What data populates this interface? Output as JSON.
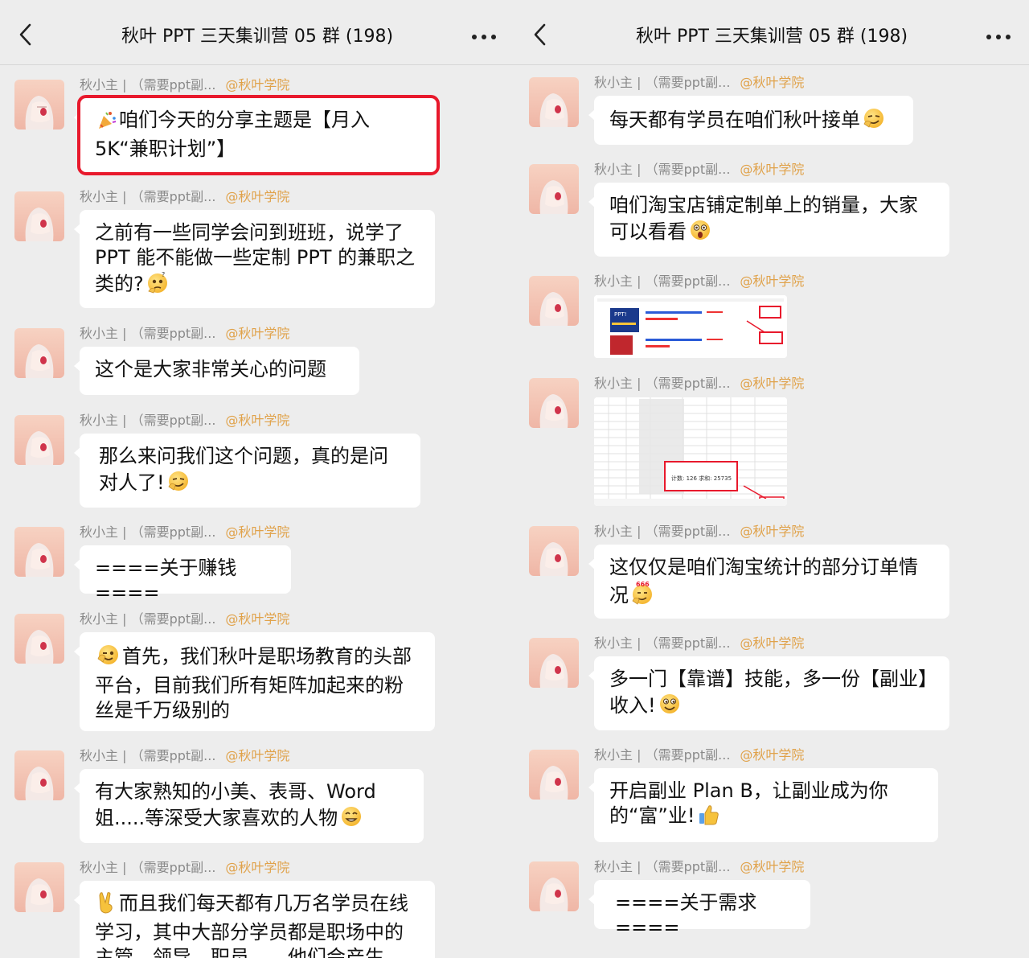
{
  "header": {
    "title": "秋叶 PPT 三天集训营 05 群 (198)",
    "back_icon": "chevron-left-icon",
    "more_icon": "more-horizontal-icon"
  },
  "sender": {
    "name": "秋小主 | （需要ppt副...",
    "at": "@秋叶学院"
  },
  "left_messages": [
    {
      "emoji": "party-popper-icon",
      "text": "咱们今天的分享主题是【月入 5K“兼职计划”】",
      "highlighted": true
    },
    {
      "text": "之前有一些同学会问到班班，说学了PPT 能不能做一些定制 PPT 的兼职之类的?",
      "emoji_after": "thinking-face-icon"
    },
    {
      "text": "这个是大家非常关心的问题"
    },
    {
      "text": "那么来问我们这个问题，真的是问对人了!",
      "emoji_after": "smirk-face-icon"
    },
    {
      "text": "====关于赚钱===="
    },
    {
      "emoji": "wink-face-icon",
      "text": "首先，我们秋叶是职场教育的头部平台，目前我们所有矩阵加起来的粉丝是千万级别的"
    },
    {
      "text": "有大家熟知的小美、表哥、Word 姐.....等深受大家喜欢的人物",
      "emoji_after": "smile-face-icon"
    },
    {
      "emoji": "victory-hand-icon",
      "text": "而且我们每天都有几万名学员在线学习，其中大部分学员都是职场中的主管、领导、职员……他们会产生"
    }
  ],
  "right_messages": [
    {
      "text": "每天都有学员在咱们秋叶接单",
      "emoji_after": "smirk-face-icon"
    },
    {
      "text": "咱们淘宝店铺定制单上的销量，大家可以看看",
      "emoji_after": "shocked-face-icon"
    },
    {
      "type": "image",
      "image_icon": "sales-screenshot-icon",
      "badge_label": "PPT!"
    },
    {
      "type": "image",
      "image_icon": "spreadsheet-screenshot-icon",
      "stats": "计数: 126   求和: 25735"
    },
    {
      "text": "这仅仅是咱们淘宝统计的部分订单情况",
      "emoji_after": "666-face-icon"
    },
    {
      "text": "多一门【靠谱】技能，多一份【副业】收入!",
      "emoji_after": "happy-face-icon"
    },
    {
      "text": "开启副业 Plan B，让副业成为你的“富”业!",
      "emoji_after": "thumbs-up-icon"
    },
    {
      "text": "====关于需求===="
    }
  ],
  "colors": {
    "background": "#ededed",
    "bubble": "#ffffff",
    "at_mention": "#e0a24a",
    "highlight": "#e8192c"
  }
}
